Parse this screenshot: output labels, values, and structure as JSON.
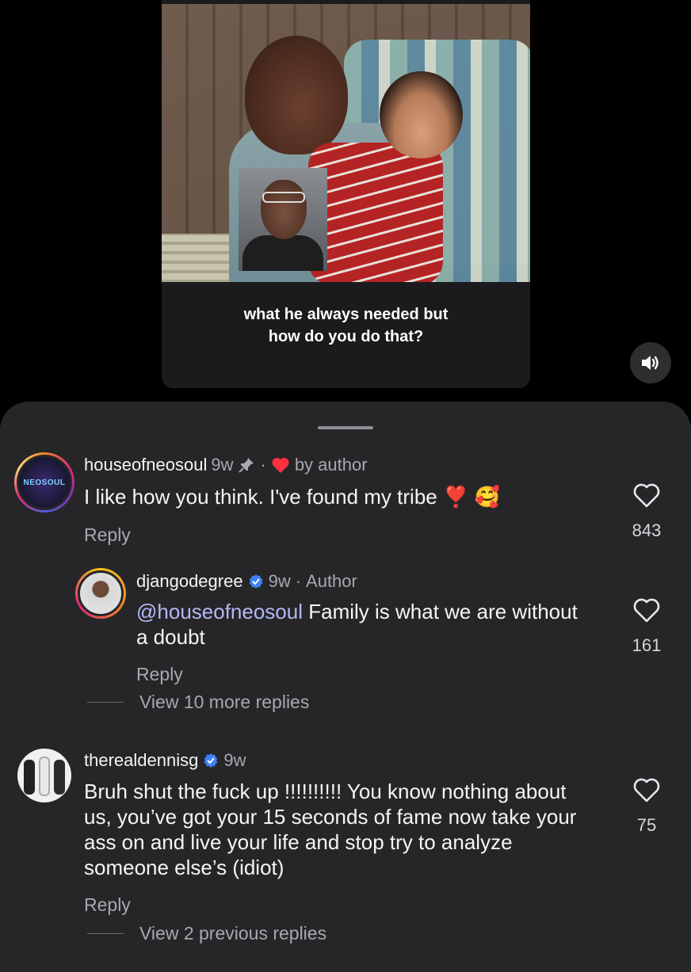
{
  "video": {
    "caption_line1": "what he always needed but",
    "caption_line2": "how do you do that?",
    "sound_icon": "speaker-volume-icon"
  },
  "comments": [
    {
      "username": "houseofneosoul",
      "time": "9w",
      "pin_icon": "pin-icon",
      "heart_by_author": "by author",
      "text": "I like how you think.  I've found my tribe ❣️ 🥰",
      "reply_label": "Reply",
      "likes": "843",
      "avatar_label": "NEOSOUL"
    },
    {
      "username": "djangodegree",
      "time": "9w",
      "author_tag": "Author",
      "mention": "@houseofneosoul",
      "text": "Family is what we are without a doubt",
      "reply_label": "Reply",
      "likes": "161",
      "view_more": "View 10 more replies"
    },
    {
      "username": "therealdennisg",
      "time": "9w",
      "text": "Bruh shut the fuck up !!!!!!!!!! You know nothing about us, you’ve got your 15 seconds of fame now take your ass on and live your life and stop try to analyze someone else’s (idiot)",
      "reply_label": "Reply",
      "likes": "75",
      "view_more": "View 2 previous replies"
    }
  ],
  "colors": {
    "sheet_bg": "#262629",
    "mention": "#b4b8f5",
    "heart_red": "#ff3040",
    "verified_blue": "#3b82f6"
  }
}
